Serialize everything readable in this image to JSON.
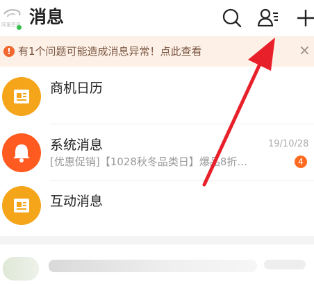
{
  "header": {
    "title": "消息",
    "avatar_text": "阿里巴巴",
    "icons": [
      "search-icon",
      "contacts-icon",
      "add-icon"
    ]
  },
  "notice": {
    "text": "有1个问题可能造成消息异常！点此查看",
    "icon": "warning-icon",
    "close": "×"
  },
  "messages": [
    {
      "name": "商机日历",
      "preview": "",
      "time": "",
      "badge": "",
      "icon": "calendar-icon",
      "color": "#f5a51a"
    },
    {
      "name": "系统消息",
      "preview": "[优惠促销]【1028秋冬品类日】爆品8折...",
      "time": "19/10/28",
      "badge": "4",
      "icon": "bell-icon",
      "color": "#ff5a1f"
    },
    {
      "name": "互动消息",
      "preview": "",
      "time": "",
      "badge": "",
      "icon": "document-icon",
      "color": "#f5a51a"
    }
  ],
  "colors": {
    "accent": "#ff5a1f",
    "orange": "#f5a51a",
    "notice_bg": "#fdf1e7",
    "arrow": "#e8202a"
  }
}
